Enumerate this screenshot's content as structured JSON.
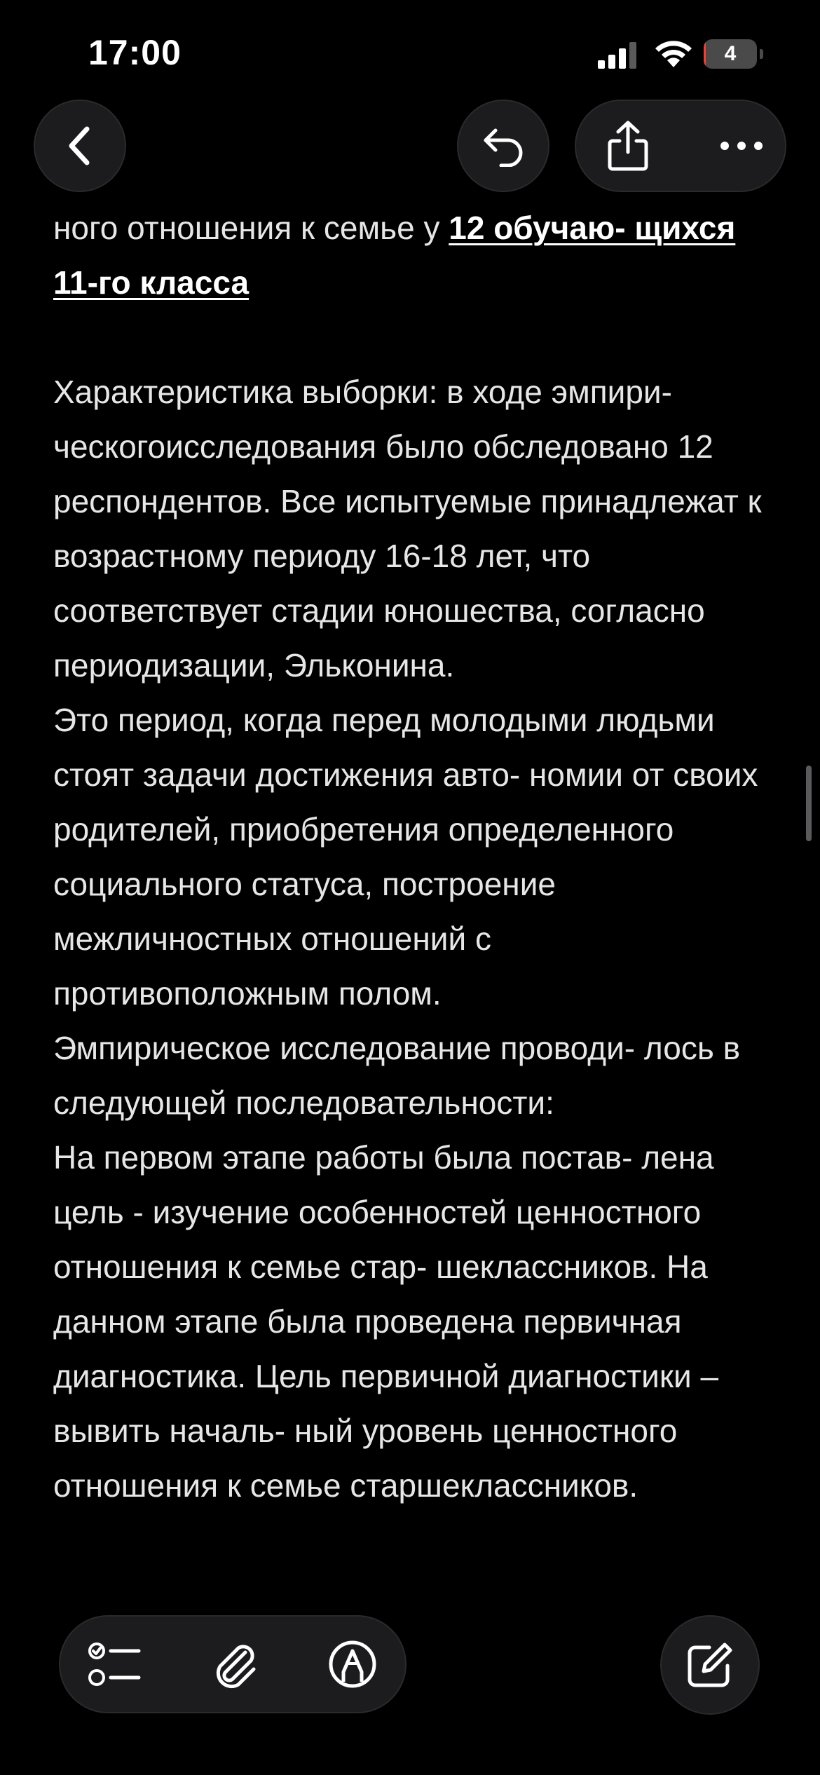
{
  "status_bar": {
    "time": "17:00",
    "battery_level": "4",
    "battery_percent": 4
  },
  "toolbar": {
    "back_icon": "chevron-left-icon",
    "undo_icon": "undo-icon",
    "share_icon": "share-icon",
    "more_icon": "ellipsis-icon"
  },
  "note": {
    "intro_text": "ного отношения к семье у ",
    "intro_highlight": "12 обучаю- щихся 11-го класса",
    "paragraph_1": "Характеристика выборки: в ходе эмпири- ческогоисследования было обследовано 12 респондентов. Все испытуемые принадлежат к возрастному периоду 16-18 лет, что соответствует стадии юношества, согласно периодизации, Эльконина.",
    "paragraph_2": "Это период, когда перед молодыми людьми стоят задачи достижения авто- номии от своих родителей, приобретения определенного социального статуса, построение межличностных отношений с противоположным полом.",
    "paragraph_3": "Эмпирическое исследование проводи- лось в следующей последовательности:",
    "paragraph_4": "На первом этапе работы была постав- лена цель - изучение особенностей ценностного отношения к семье стар- шеклассников. На данном этапе была проведена первичная диагностика. Цель первичной диагностики – вывить началь- ный уровень ценностного отношения к семье старшеклассников."
  },
  "bottom_toolbar": {
    "checklist_icon": "checklist-icon",
    "attachment_icon": "paperclip-icon",
    "markup_icon": "markup-pen-icon",
    "compose_icon": "compose-icon"
  },
  "colors": {
    "background": "#000000",
    "button_fill": "#1c1c1e",
    "text": "#e6e6e6",
    "battery_low": "#ff3b30"
  }
}
